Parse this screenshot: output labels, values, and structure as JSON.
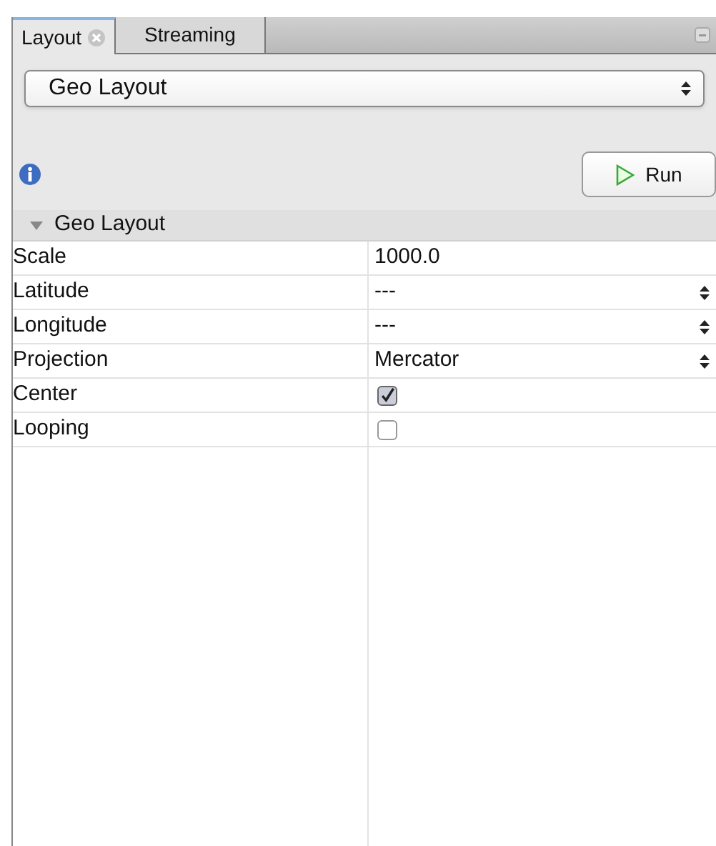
{
  "tabs": [
    {
      "label": "Layout",
      "selected": true,
      "closable": true
    },
    {
      "label": "Streaming",
      "selected": false,
      "closable": false
    }
  ],
  "layout_select": {
    "value": "Geo Layout"
  },
  "run_button": {
    "label": "Run"
  },
  "properties": {
    "section": {
      "title": "Geo Layout",
      "expanded": true
    },
    "rows": [
      {
        "name": "Scale",
        "kind": "text",
        "value": "1000.0"
      },
      {
        "name": "Latitude",
        "kind": "spinner",
        "value": "---"
      },
      {
        "name": "Longitude",
        "kind": "spinner",
        "value": "---"
      },
      {
        "name": "Projection",
        "kind": "combo",
        "value": "Mercator"
      },
      {
        "name": "Center",
        "kind": "checkbox",
        "checked": true
      },
      {
        "name": "Looping",
        "kind": "checkbox",
        "checked": false
      }
    ]
  }
}
